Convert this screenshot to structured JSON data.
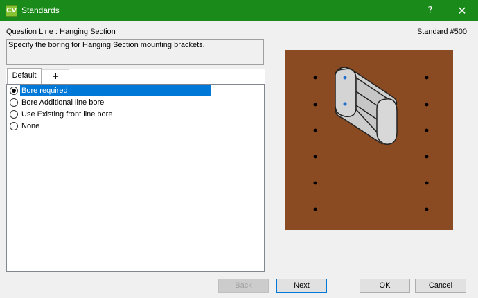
{
  "window": {
    "app_icon_text": "CV",
    "title": "Standards",
    "help_glyph": "?",
    "close_glyph": "✕"
  },
  "header": {
    "question_line": "Question Line : Hanging Section",
    "standard_number": "Standard #500"
  },
  "description": "Specify the boring for Hanging Section mounting brackets.",
  "tabs": [
    {
      "label": "Default",
      "selected": true
    },
    {
      "label": "+",
      "selected": false
    }
  ],
  "options": [
    {
      "label": "Bore required",
      "checked": true
    },
    {
      "label": "Bore Additional line bore",
      "checked": false
    },
    {
      "label": "Use Existing front line bore",
      "checked": false
    },
    {
      "label": "None",
      "checked": false
    }
  ],
  "buttons": {
    "back": "Back",
    "next": "Next",
    "ok": "OK",
    "cancel": "Cancel"
  },
  "colors": {
    "titlebar": "#1a8b1a",
    "preview_background": "#8b4b22",
    "selection": "#0078d7"
  }
}
